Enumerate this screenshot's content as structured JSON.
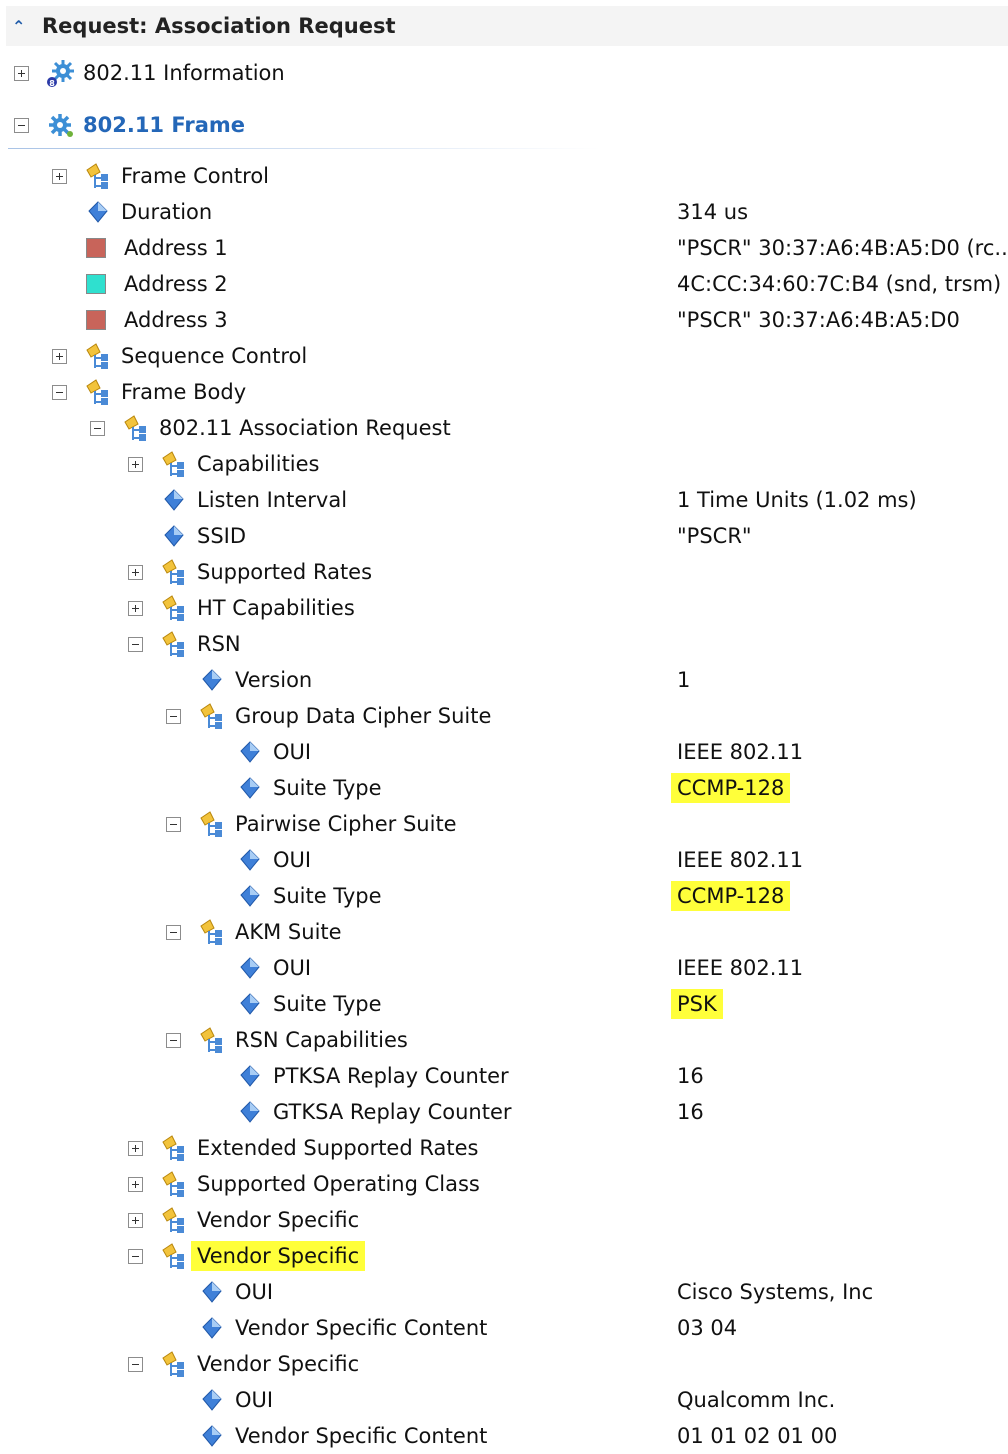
{
  "header": {
    "title": "Request: Association Request"
  },
  "top_nodes": [
    {
      "label": "802.11 Information",
      "expander": "plus"
    },
    {
      "label": "802.11 Frame",
      "expander": "minus"
    }
  ],
  "colors": {
    "address_red": "#c8645a",
    "address_cyan": "#2fe0cf",
    "highlight": "#ffff3a",
    "accent": "#2467b8"
  },
  "tree": [
    {
      "level": 0,
      "expander": "plus",
      "icon": "struct-icon",
      "label": "Frame Control",
      "value": ""
    },
    {
      "level": 0,
      "expander": "",
      "icon": "field-icon",
      "label": "Duration",
      "value": "314 us"
    },
    {
      "level": 0,
      "expander": "",
      "icon": "swatch-red",
      "label": "Address 1",
      "value": "\"PSCR\" 30:37:A6:4B:A5:D0 (rc..."
    },
    {
      "level": 0,
      "expander": "",
      "icon": "swatch-cyan",
      "label": "Address 2",
      "value": "4C:CC:34:60:7C:B4 (snd, trsm)"
    },
    {
      "level": 0,
      "expander": "",
      "icon": "swatch-red",
      "label": "Address 3",
      "value": "\"PSCR\" 30:37:A6:4B:A5:D0"
    },
    {
      "level": 0,
      "expander": "plus",
      "icon": "struct-icon",
      "label": "Sequence Control",
      "value": ""
    },
    {
      "level": 0,
      "expander": "minus",
      "icon": "struct-icon",
      "label": "Frame Body",
      "value": ""
    },
    {
      "level": 1,
      "expander": "minus",
      "icon": "struct-icon",
      "label": "802.11 Association Request",
      "value": ""
    },
    {
      "level": 2,
      "expander": "plus",
      "icon": "struct-icon",
      "label": "Capabilities",
      "value": ""
    },
    {
      "level": 2,
      "expander": "",
      "icon": "field-icon",
      "label": "Listen Interval",
      "value": "1 Time Units (1.02 ms)"
    },
    {
      "level": 2,
      "expander": "",
      "icon": "field-icon",
      "label": "SSID",
      "value": "\"PSCR\""
    },
    {
      "level": 2,
      "expander": "plus",
      "icon": "struct-icon",
      "label": "Supported Rates",
      "value": ""
    },
    {
      "level": 2,
      "expander": "plus",
      "icon": "struct-icon",
      "label": "HT Capabilities",
      "value": ""
    },
    {
      "level": 2,
      "expander": "minus",
      "icon": "struct-icon",
      "label": "RSN",
      "value": ""
    },
    {
      "level": 3,
      "expander": "",
      "icon": "field-icon",
      "label": "Version",
      "value": "1"
    },
    {
      "level": 3,
      "expander": "minus",
      "icon": "struct-icon",
      "label": "Group Data Cipher Suite",
      "value": ""
    },
    {
      "level": 4,
      "expander": "",
      "icon": "field-icon",
      "label": "OUI",
      "value": "IEEE 802.11"
    },
    {
      "level": 4,
      "expander": "",
      "icon": "field-icon",
      "label": "Suite Type",
      "value": "CCMP-128",
      "value_highlight": true
    },
    {
      "level": 3,
      "expander": "minus",
      "icon": "struct-icon",
      "label": "Pairwise Cipher Suite",
      "value": ""
    },
    {
      "level": 4,
      "expander": "",
      "icon": "field-icon",
      "label": "OUI",
      "value": "IEEE 802.11"
    },
    {
      "level": 4,
      "expander": "",
      "icon": "field-icon",
      "label": "Suite Type",
      "value": "CCMP-128",
      "value_highlight": true
    },
    {
      "level": 3,
      "expander": "minus",
      "icon": "struct-icon",
      "label": "AKM Suite",
      "value": ""
    },
    {
      "level": 4,
      "expander": "",
      "icon": "field-icon",
      "label": "OUI",
      "value": "IEEE 802.11"
    },
    {
      "level": 4,
      "expander": "",
      "icon": "field-icon",
      "label": "Suite Type",
      "value": "PSK",
      "value_highlight": true
    },
    {
      "level": 3,
      "expander": "minus",
      "icon": "struct-icon",
      "label": "RSN Capabilities",
      "value": ""
    },
    {
      "level": 4,
      "expander": "",
      "icon": "field-icon",
      "label": "PTKSA Replay Counter",
      "value": "16"
    },
    {
      "level": 4,
      "expander": "",
      "icon": "field-icon",
      "label": "GTKSA Replay Counter",
      "value": "16"
    },
    {
      "level": 2,
      "expander": "plus",
      "icon": "struct-icon",
      "label": "Extended Supported Rates",
      "value": ""
    },
    {
      "level": 2,
      "expander": "plus",
      "icon": "struct-icon",
      "label": "Supported Operating Class",
      "value": ""
    },
    {
      "level": 2,
      "expander": "plus",
      "icon": "struct-icon",
      "label": "Vendor Specific",
      "value": ""
    },
    {
      "level": 2,
      "expander": "minus",
      "icon": "struct-icon",
      "label": "Vendor Specific",
      "value": "",
      "label_highlight": true
    },
    {
      "level": 3,
      "expander": "",
      "icon": "field-icon",
      "label": "OUI",
      "value": "Cisco Systems, Inc"
    },
    {
      "level": 3,
      "expander": "",
      "icon": "field-icon",
      "label": "Vendor Specific Content",
      "value": "03 04"
    },
    {
      "level": 2,
      "expander": "minus",
      "icon": "struct-icon",
      "label": "Vendor Specific",
      "value": ""
    },
    {
      "level": 3,
      "expander": "",
      "icon": "field-icon",
      "label": "OUI",
      "value": "Qualcomm Inc."
    },
    {
      "level": 3,
      "expander": "",
      "icon": "field-icon",
      "label": "Vendor Specific Content",
      "value": "01 01 02 01 00"
    }
  ]
}
